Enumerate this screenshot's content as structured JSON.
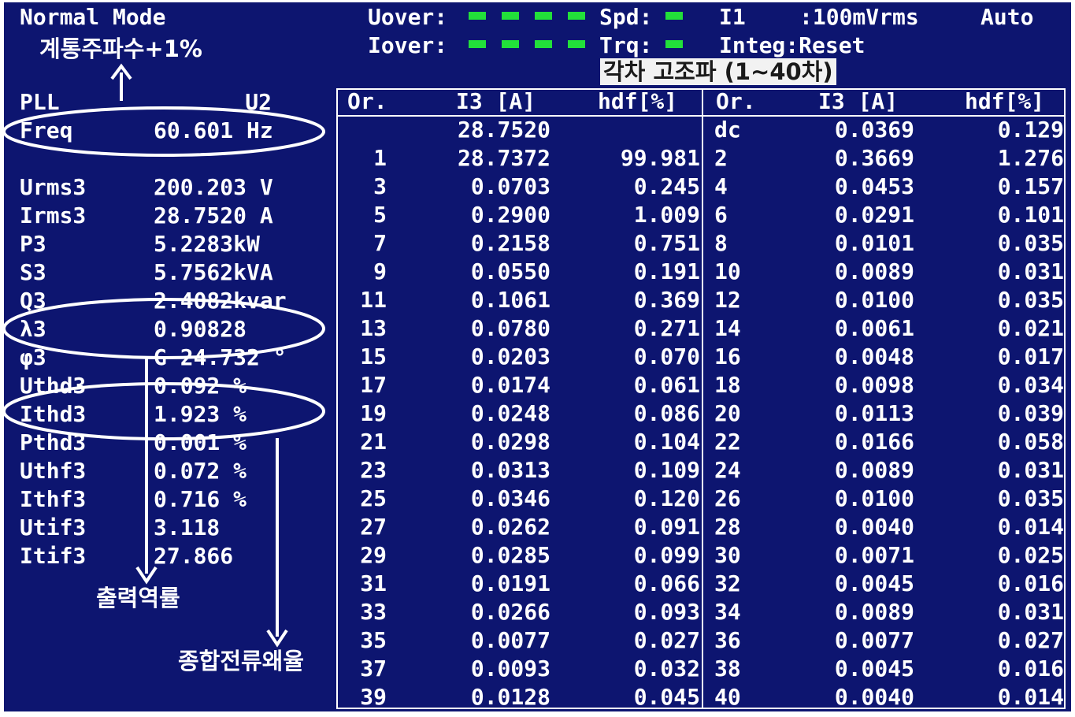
{
  "header": {
    "mode": "Normal Mode",
    "uover_label": "Uover:",
    "iover_label": "Iover:",
    "spd_label": "Spd:",
    "trq_label": "Trq:",
    "i1_label": "I1",
    "i1_value": ":100mVrms",
    "auto": "Auto",
    "integ": "Integ:Reset",
    "led_color": "#22e03a"
  },
  "left": {
    "pll_label": "PLL",
    "pll_value": "U2",
    "items": [
      {
        "label": "Freq",
        "value": "60.601 Hz"
      },
      {
        "label": "Urms3",
        "value": "200.203 V"
      },
      {
        "label": "Irms3",
        "value": "28.7520 A"
      },
      {
        "label": "P3",
        "value": "5.2283kW"
      },
      {
        "label": "S3",
        "value": "5.7562kVA"
      },
      {
        "label": "Q3",
        "value": "2.4082kvar"
      },
      {
        "label": "λ3",
        "value": "0.90828"
      },
      {
        "label": "φ3",
        "value": "G 24.732 °"
      },
      {
        "label": "Uthd3",
        "value": "0.092 %"
      },
      {
        "label": "Ithd3",
        "value": "1.923 %"
      },
      {
        "label": "Pthd3",
        "value": "0.001 %"
      },
      {
        "label": "Uthf3",
        "value": "0.072 %"
      },
      {
        "label": "Ithf3",
        "value": "0.716 %"
      },
      {
        "label": "Utif3",
        "value": "3.118"
      },
      {
        "label": "Itif3",
        "value": "27.866"
      }
    ]
  },
  "table": {
    "headers": [
      "Or.",
      "I3 [A]",
      "hdf[%]",
      "Or.",
      "I3 [A]",
      "hdf[%]"
    ],
    "rows": [
      [
        "",
        "28.7520",
        "",
        "dc",
        "0.0369",
        "0.129"
      ],
      [
        "1",
        "28.7372",
        "99.981",
        "2",
        "0.3669",
        "1.276"
      ],
      [
        "3",
        "0.0703",
        "0.245",
        "4",
        "0.0453",
        "0.157"
      ],
      [
        "5",
        "0.2900",
        "1.009",
        "6",
        "0.0291",
        "0.101"
      ],
      [
        "7",
        "0.2158",
        "0.751",
        "8",
        "0.0101",
        "0.035"
      ],
      [
        "9",
        "0.0550",
        "0.191",
        "10",
        "0.0089",
        "0.031"
      ],
      [
        "11",
        "0.1061",
        "0.369",
        "12",
        "0.0100",
        "0.035"
      ],
      [
        "13",
        "0.0780",
        "0.271",
        "14",
        "0.0061",
        "0.021"
      ],
      [
        "15",
        "0.0203",
        "0.070",
        "16",
        "0.0048",
        "0.017"
      ],
      [
        "17",
        "0.0174",
        "0.061",
        "18",
        "0.0098",
        "0.034"
      ],
      [
        "19",
        "0.0248",
        "0.086",
        "20",
        "0.0113",
        "0.039"
      ],
      [
        "21",
        "0.0298",
        "0.104",
        "22",
        "0.0166",
        "0.058"
      ],
      [
        "23",
        "0.0313",
        "0.109",
        "24",
        "0.0089",
        "0.031"
      ],
      [
        "25",
        "0.0346",
        "0.120",
        "26",
        "0.0100",
        "0.035"
      ],
      [
        "27",
        "0.0262",
        "0.091",
        "28",
        "0.0040",
        "0.014"
      ],
      [
        "29",
        "0.0285",
        "0.099",
        "30",
        "0.0071",
        "0.025"
      ],
      [
        "31",
        "0.0191",
        "0.066",
        "32",
        "0.0045",
        "0.016"
      ],
      [
        "33",
        "0.0266",
        "0.093",
        "34",
        "0.0089",
        "0.031"
      ],
      [
        "35",
        "0.0077",
        "0.027",
        "36",
        "0.0077",
        "0.027"
      ],
      [
        "37",
        "0.0093",
        "0.032",
        "38",
        "0.0045",
        "0.016"
      ],
      [
        "39",
        "0.0128",
        "0.045",
        "40",
        "0.0040",
        "0.014"
      ]
    ]
  },
  "annotations": {
    "freq_note": "계통주파수+1%",
    "harmonics_note": "각차 고조파 (1~40차)",
    "pf_note": "출력역률",
    "thd_note": "종합전류왜율"
  }
}
